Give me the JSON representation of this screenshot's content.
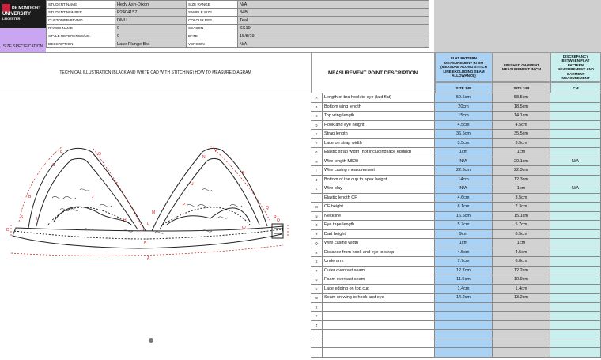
{
  "logo": {
    "line1": "DE MONTFORT",
    "line2": "UNIVERSITY",
    "line3": "LEICESTER"
  },
  "size_spec_label": "SIZE SPECIFICATION",
  "header_left": [
    {
      "label": "STUDENT NAME",
      "value": "Hedy Ash-Dixon"
    },
    {
      "label": "STUDENT NUMBER",
      "value": "P2404157"
    },
    {
      "label": "CUSTOMER/BRAND",
      "value": "DMU"
    },
    {
      "label": "RANGE NAME",
      "value": "0"
    },
    {
      "label": "STYLE REFERENCE/NO.",
      "value": "0"
    },
    {
      "label": "DESCRIPTION",
      "value": "Lace Plunge Bra"
    }
  ],
  "header_right": [
    {
      "label": "SIZE RANGE",
      "value": "N/A"
    },
    {
      "label": "SAMPLE SIZE",
      "value": "34B"
    },
    {
      "label": "COLOUR REF",
      "value": "Teal"
    },
    {
      "label": "SEASON",
      "value": "SS19"
    },
    {
      "label": "DATE",
      "value": "15/8/19"
    },
    {
      "label": "VERSION",
      "value": "N/A"
    }
  ],
  "tech_title": "TECHNICAL ILLUSTRATION  (BLACK AND WHITE CAD WITH STITCHING)  HOW TO MEASURE DIAGRAM",
  "mp_title": "MEASUREMENT POINT DESCRIPTION",
  "col_flat": "FLAT PATTERN MEASUREMENT IN CM (MEASURE ALONG STITCH LINE EXCLUDING SEAM ALLOWANCE)",
  "col_finished": "FINISHED GARMENT MEASUREMENT IN CM",
  "col_disc": "DISCREPANCY BETWEEN FLAT PATTERN MEASUREMENT AND GARMENT MEASUREMENT",
  "size_flat": "SIZE 34B",
  "size_finished": "SIZE 34B",
  "size_disc": "CM",
  "rows": [
    {
      "letter": "A",
      "desc": "Length of bra hook to eye (laid flat)",
      "flat": "59.5cm",
      "fin": "58.5cm",
      "disc": ""
    },
    {
      "letter": "B",
      "desc": "Bottom wing length",
      "flat": "20cm",
      "fin": "18.5cm",
      "disc": ""
    },
    {
      "letter": "C",
      "desc": "Top wing length",
      "flat": "15cm",
      "fin": "14.1cm",
      "disc": ""
    },
    {
      "letter": "D",
      "desc": "Hook and eye height",
      "flat": "4.5cm",
      "fin": "4.5cm",
      "disc": ""
    },
    {
      "letter": "E",
      "desc": "Strap length",
      "flat": "36.5cm",
      "fin": "35.5cm",
      "disc": ""
    },
    {
      "letter": "F",
      "desc": "Lace on strap width",
      "flat": "3.5cm",
      "fin": "3.5cm",
      "disc": ""
    },
    {
      "letter": "G",
      "desc": "Elastic strap width (not including lace edging)",
      "flat": "1cm",
      "fin": "1cm",
      "disc": ""
    },
    {
      "letter": "H",
      "desc": "Wire length M520",
      "flat": "N/A",
      "fin": "20.1cm",
      "disc": "N/A"
    },
    {
      "letter": "I",
      "desc": "Wire casing measurement",
      "flat": "22.5cm",
      "fin": "22.3cm",
      "disc": ""
    },
    {
      "letter": "J",
      "desc": "Bottom of the cup to apex height",
      "flat": "14cm",
      "fin": "12.3cm",
      "disc": ""
    },
    {
      "letter": "K",
      "desc": "Wire play",
      "flat": "N/A",
      "fin": "1cm",
      "disc": "N/A"
    },
    {
      "letter": "L",
      "desc": "Elastic length CF",
      "flat": "4.6cm",
      "fin": "3.5cm",
      "disc": ""
    },
    {
      "letter": "M",
      "desc": "CF height",
      "flat": "8.1cm",
      "fin": "7.3cm",
      "disc": ""
    },
    {
      "letter": "N",
      "desc": "Neckline",
      "flat": "16.5cm",
      "fin": "15.1cm",
      "disc": ""
    },
    {
      "letter": "O",
      "desc": "Eye tape length",
      "flat": "5.7cm",
      "fin": "5.7cm",
      "disc": ""
    },
    {
      "letter": "P",
      "desc": "Dart height",
      "flat": "9cm",
      "fin": "8.5cm",
      "disc": ""
    },
    {
      "letter": "Q",
      "desc": "Wire casing width",
      "flat": "1cm",
      "fin": "1cm",
      "disc": ""
    },
    {
      "letter": "R",
      "desc": "Distance from hook and eye to strap",
      "flat": "4.5cm",
      "fin": "4.5cm",
      "disc": ""
    },
    {
      "letter": "S",
      "desc": "Underarm",
      "flat": "7.7cm",
      "fin": "6.8cm",
      "disc": ""
    },
    {
      "letter": "T",
      "desc": "Outer overcast seam",
      "flat": "12.7cm",
      "fin": "12.2cm",
      "disc": ""
    },
    {
      "letter": "U",
      "desc": "Foam overcast seam",
      "flat": "11.5cm",
      "fin": "10.9cm",
      "disc": ""
    },
    {
      "letter": "V",
      "desc": "Lace edging on top cup",
      "flat": "1.4cm",
      "fin": "1.4cm",
      "disc": ""
    },
    {
      "letter": "W",
      "desc": "Seam on wing to hook and eye",
      "flat": "14.2cm",
      "fin": "13.2cm",
      "disc": ""
    },
    {
      "letter": "X",
      "desc": "",
      "flat": "",
      "fin": "",
      "disc": ""
    },
    {
      "letter": "Y",
      "desc": "",
      "flat": "",
      "fin": "",
      "disc": ""
    },
    {
      "letter": "Z",
      "desc": "",
      "flat": "",
      "fin": "",
      "disc": ""
    },
    {
      "letter": "",
      "desc": "",
      "flat": "",
      "fin": "",
      "disc": ""
    },
    {
      "letter": "",
      "desc": "",
      "flat": "",
      "fin": "",
      "disc": ""
    },
    {
      "letter": "",
      "desc": "",
      "flat": "",
      "fin": "",
      "disc": ""
    }
  ],
  "diagram_labels": [
    "A",
    "B",
    "C",
    "D",
    "E",
    "F",
    "G",
    "H",
    "I",
    "J",
    "K",
    "L",
    "M",
    "N",
    "O",
    "P",
    "Q",
    "R",
    "S",
    "T",
    "U",
    "V",
    "W"
  ]
}
